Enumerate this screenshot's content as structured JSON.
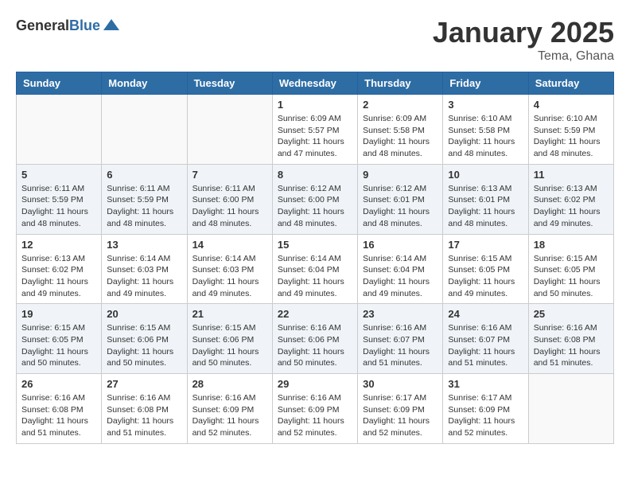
{
  "header": {
    "logo_general": "General",
    "logo_blue": "Blue",
    "month_title": "January 2025",
    "location": "Tema, Ghana"
  },
  "weekdays": [
    "Sunday",
    "Monday",
    "Tuesday",
    "Wednesday",
    "Thursday",
    "Friday",
    "Saturday"
  ],
  "weeks": [
    {
      "shaded": false,
      "days": [
        {
          "num": "",
          "info": ""
        },
        {
          "num": "",
          "info": ""
        },
        {
          "num": "",
          "info": ""
        },
        {
          "num": "1",
          "info": "Sunrise: 6:09 AM\nSunset: 5:57 PM\nDaylight: 11 hours and 47 minutes."
        },
        {
          "num": "2",
          "info": "Sunrise: 6:09 AM\nSunset: 5:58 PM\nDaylight: 11 hours and 48 minutes."
        },
        {
          "num": "3",
          "info": "Sunrise: 6:10 AM\nSunset: 5:58 PM\nDaylight: 11 hours and 48 minutes."
        },
        {
          "num": "4",
          "info": "Sunrise: 6:10 AM\nSunset: 5:59 PM\nDaylight: 11 hours and 48 minutes."
        }
      ]
    },
    {
      "shaded": true,
      "days": [
        {
          "num": "5",
          "info": "Sunrise: 6:11 AM\nSunset: 5:59 PM\nDaylight: 11 hours and 48 minutes."
        },
        {
          "num": "6",
          "info": "Sunrise: 6:11 AM\nSunset: 5:59 PM\nDaylight: 11 hours and 48 minutes."
        },
        {
          "num": "7",
          "info": "Sunrise: 6:11 AM\nSunset: 6:00 PM\nDaylight: 11 hours and 48 minutes."
        },
        {
          "num": "8",
          "info": "Sunrise: 6:12 AM\nSunset: 6:00 PM\nDaylight: 11 hours and 48 minutes."
        },
        {
          "num": "9",
          "info": "Sunrise: 6:12 AM\nSunset: 6:01 PM\nDaylight: 11 hours and 48 minutes."
        },
        {
          "num": "10",
          "info": "Sunrise: 6:13 AM\nSunset: 6:01 PM\nDaylight: 11 hours and 48 minutes."
        },
        {
          "num": "11",
          "info": "Sunrise: 6:13 AM\nSunset: 6:02 PM\nDaylight: 11 hours and 49 minutes."
        }
      ]
    },
    {
      "shaded": false,
      "days": [
        {
          "num": "12",
          "info": "Sunrise: 6:13 AM\nSunset: 6:02 PM\nDaylight: 11 hours and 49 minutes."
        },
        {
          "num": "13",
          "info": "Sunrise: 6:14 AM\nSunset: 6:03 PM\nDaylight: 11 hours and 49 minutes."
        },
        {
          "num": "14",
          "info": "Sunrise: 6:14 AM\nSunset: 6:03 PM\nDaylight: 11 hours and 49 minutes."
        },
        {
          "num": "15",
          "info": "Sunrise: 6:14 AM\nSunset: 6:04 PM\nDaylight: 11 hours and 49 minutes."
        },
        {
          "num": "16",
          "info": "Sunrise: 6:14 AM\nSunset: 6:04 PM\nDaylight: 11 hours and 49 minutes."
        },
        {
          "num": "17",
          "info": "Sunrise: 6:15 AM\nSunset: 6:05 PM\nDaylight: 11 hours and 49 minutes."
        },
        {
          "num": "18",
          "info": "Sunrise: 6:15 AM\nSunset: 6:05 PM\nDaylight: 11 hours and 50 minutes."
        }
      ]
    },
    {
      "shaded": true,
      "days": [
        {
          "num": "19",
          "info": "Sunrise: 6:15 AM\nSunset: 6:05 PM\nDaylight: 11 hours and 50 minutes."
        },
        {
          "num": "20",
          "info": "Sunrise: 6:15 AM\nSunset: 6:06 PM\nDaylight: 11 hours and 50 minutes."
        },
        {
          "num": "21",
          "info": "Sunrise: 6:15 AM\nSunset: 6:06 PM\nDaylight: 11 hours and 50 minutes."
        },
        {
          "num": "22",
          "info": "Sunrise: 6:16 AM\nSunset: 6:06 PM\nDaylight: 11 hours and 50 minutes."
        },
        {
          "num": "23",
          "info": "Sunrise: 6:16 AM\nSunset: 6:07 PM\nDaylight: 11 hours and 51 minutes."
        },
        {
          "num": "24",
          "info": "Sunrise: 6:16 AM\nSunset: 6:07 PM\nDaylight: 11 hours and 51 minutes."
        },
        {
          "num": "25",
          "info": "Sunrise: 6:16 AM\nSunset: 6:08 PM\nDaylight: 11 hours and 51 minutes."
        }
      ]
    },
    {
      "shaded": false,
      "days": [
        {
          "num": "26",
          "info": "Sunrise: 6:16 AM\nSunset: 6:08 PM\nDaylight: 11 hours and 51 minutes."
        },
        {
          "num": "27",
          "info": "Sunrise: 6:16 AM\nSunset: 6:08 PM\nDaylight: 11 hours and 51 minutes."
        },
        {
          "num": "28",
          "info": "Sunrise: 6:16 AM\nSunset: 6:09 PM\nDaylight: 11 hours and 52 minutes."
        },
        {
          "num": "29",
          "info": "Sunrise: 6:16 AM\nSunset: 6:09 PM\nDaylight: 11 hours and 52 minutes."
        },
        {
          "num": "30",
          "info": "Sunrise: 6:17 AM\nSunset: 6:09 PM\nDaylight: 11 hours and 52 minutes."
        },
        {
          "num": "31",
          "info": "Sunrise: 6:17 AM\nSunset: 6:09 PM\nDaylight: 11 hours and 52 minutes."
        },
        {
          "num": "",
          "info": ""
        }
      ]
    }
  ]
}
